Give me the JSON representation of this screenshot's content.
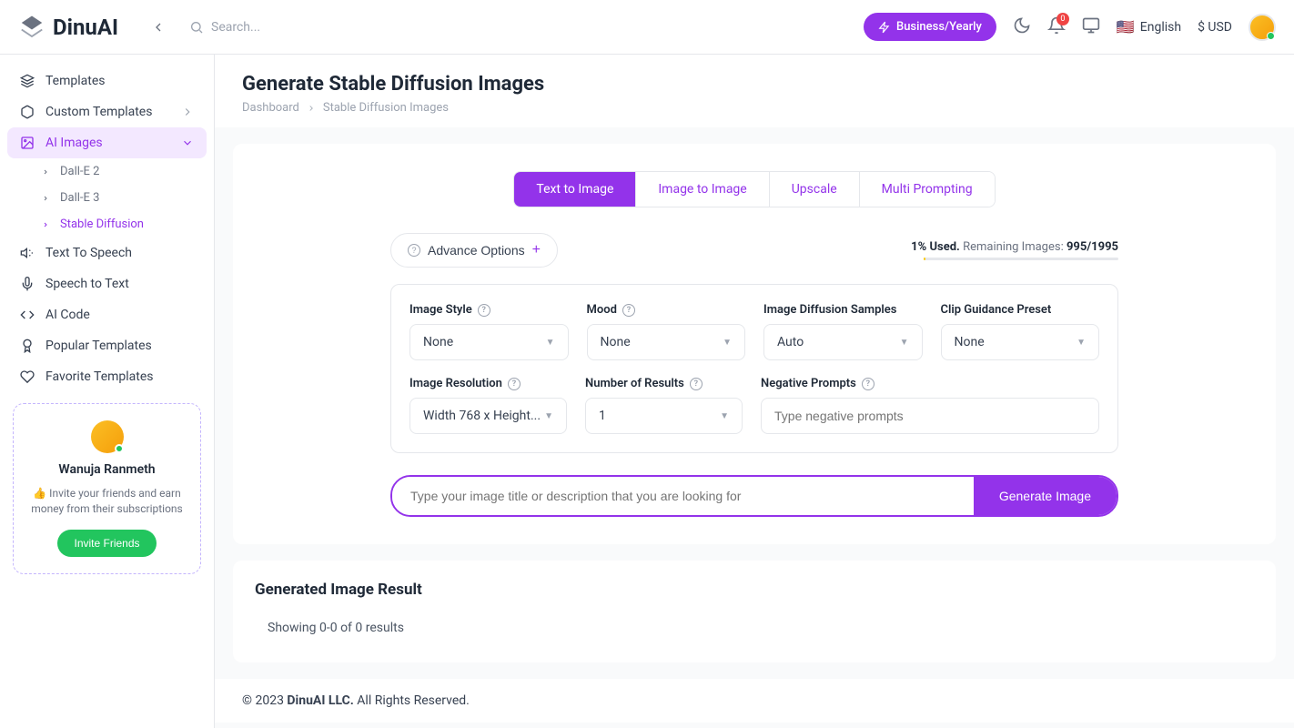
{
  "header": {
    "logo": "DinuAI",
    "search_placeholder": "Search...",
    "plan": "Business/Yearly",
    "notif_count": "0",
    "language": "English",
    "currency": "$ USD"
  },
  "sidebar": {
    "items": [
      {
        "label": "Templates"
      },
      {
        "label": "Custom Templates"
      },
      {
        "label": "AI Images"
      },
      {
        "label": "Text To Speech"
      },
      {
        "label": "Speech to Text"
      },
      {
        "label": "AI Code"
      },
      {
        "label": "Popular Templates"
      },
      {
        "label": "Favorite Templates"
      }
    ],
    "aiImagesSub": [
      {
        "label": "Dall-E 2"
      },
      {
        "label": "Dall-E 3"
      },
      {
        "label": "Stable Diffusion"
      }
    ],
    "invite": {
      "name": "Wanuja Ranmeth",
      "desc": "👍 Invite your friends and earn money from their subscriptions",
      "button": "Invite Friends"
    }
  },
  "page": {
    "title": "Generate Stable Diffusion Images",
    "breadcrumb": [
      "Dashboard",
      "Stable Diffusion Images"
    ]
  },
  "tabs": [
    "Text to Image",
    "Image to Image",
    "Upscale",
    "Multi Prompting"
  ],
  "advance_label": "Advance Options",
  "usage": {
    "used_label": "1% Used.",
    "remaining_label": "Remaining Images:",
    "remaining_value": "995/1995"
  },
  "form": {
    "image_style": {
      "label": "Image Style",
      "value": "None"
    },
    "mood": {
      "label": "Mood",
      "value": "None"
    },
    "diffusion_samples": {
      "label": "Image Diffusion Samples",
      "value": "Auto"
    },
    "clip_preset": {
      "label": "Clip Guidance Preset",
      "value": "None"
    },
    "resolution": {
      "label": "Image Resolution",
      "value": "Width 768 x Height..."
    },
    "num_results": {
      "label": "Number of Results",
      "value": "1"
    },
    "negative_prompts": {
      "label": "Negative Prompts",
      "placeholder": "Type negative prompts"
    },
    "prompt_placeholder": "Type your image title or description that you are looking for",
    "generate_button": "Generate Image"
  },
  "results": {
    "title": "Generated Image Result",
    "count": "Showing 0-0 of 0 results"
  },
  "footer": {
    "copyright": "© 2023 ",
    "company": "DinuAI LLC.",
    "rights": " All Rights Reserved."
  }
}
